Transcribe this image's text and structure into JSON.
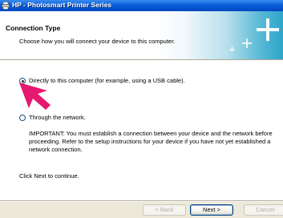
{
  "window": {
    "title": "HP - Photosmart Printer Series"
  },
  "header": {
    "title": "Connection Type",
    "subtitle": "Choose how you will connect your device to this computer."
  },
  "options": [
    {
      "label": "Directly to this computer (for example, using a USB cable).",
      "selected": true
    },
    {
      "label": "Through the network.",
      "selected": false
    }
  ],
  "important_note": "IMPORTANT:  You must establish a connection between your device and the network before proceeding.  Refer to the setup instructions for your device if you have not yet established a network connection.",
  "instruction": "Click Next to continue.",
  "buttons": {
    "back": "< Back",
    "next": "Next >",
    "cancel": "Cancel"
  },
  "colors": {
    "titlebar": "#0a5fd8",
    "pointer": "#e6186f",
    "header_accent": "#2ea5cb"
  }
}
